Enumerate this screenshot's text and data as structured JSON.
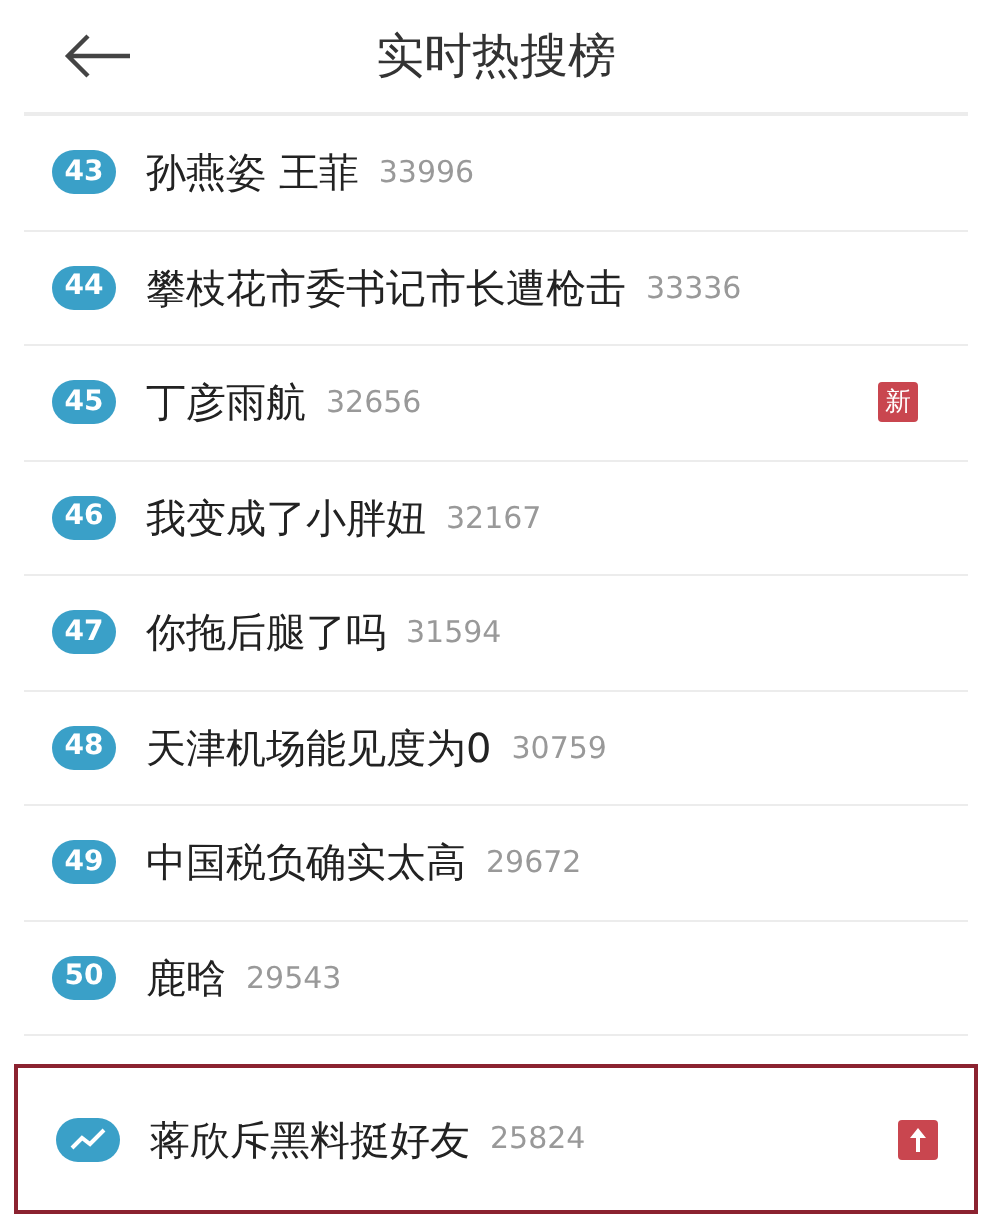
{
  "header": {
    "title": "实时热搜榜"
  },
  "items": [
    {
      "kind": "rank",
      "rank": "43",
      "text": "孙燕姿 王菲",
      "count": "33996",
      "highlighted": false
    },
    {
      "kind": "rank",
      "rank": "44",
      "text": "攀枝花市委书记市长遭枪击",
      "count": "33336",
      "highlighted": false
    },
    {
      "kind": "rank",
      "rank": "45",
      "text": "丁彦雨航",
      "count": "32656",
      "highlighted": false,
      "badge": {
        "kind": "new",
        "text": "新"
      }
    },
    {
      "kind": "rank",
      "rank": "46",
      "text": "我变成了小胖妞",
      "count": "32167",
      "highlighted": false
    },
    {
      "kind": "rank",
      "rank": "47",
      "text": "你拖后腿了吗",
      "count": "31594",
      "highlighted": false
    },
    {
      "kind": "rank",
      "rank": "48",
      "text": "天津机场能见度为0",
      "count": "30759",
      "highlighted": false
    },
    {
      "kind": "rank",
      "rank": "49",
      "text": "中国税负确实太高",
      "count": "29672",
      "highlighted": false
    },
    {
      "kind": "rank",
      "rank": "50",
      "text": "鹿晗",
      "count": "29543",
      "highlighted": false
    },
    {
      "kind": "trend",
      "text": "蒋欣斥黑料挺好友",
      "count": "25824",
      "highlighted": true,
      "badge": {
        "kind": "rising"
      }
    }
  ]
}
